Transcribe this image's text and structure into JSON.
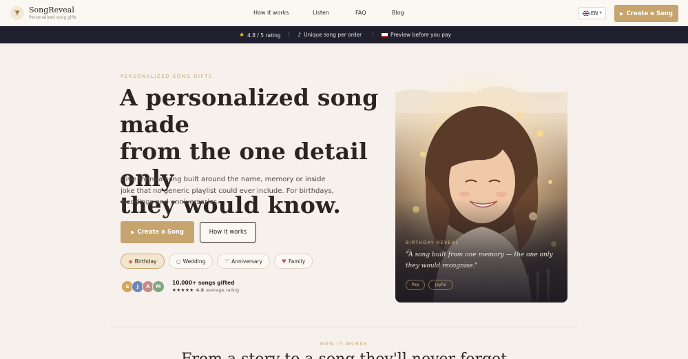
{
  "header": {
    "brand": "SongReveal",
    "tagline": "Personalized song gifts",
    "nav": [
      "How it works",
      "Listen",
      "FAQ",
      "Blog"
    ],
    "lang": "EN",
    "cta": "Create a Song"
  },
  "bar": {
    "rating": "4.8 / 5 rating",
    "unique": "Unique song per order",
    "preview": "Preview before you pay"
  },
  "hero": {
    "eyebrow": "PERSONALIZED SONG GIFTS",
    "heading_lines": [
      "A personalized song made",
      "from the one detail only",
      "they would know."
    ],
    "lead": "Give them a song built around the name, memory or inside joke that no generic playlist could ever include. For birthdays, weddings and anniversaries.",
    "primary_cta": "Create a Song",
    "secondary_cta": "How it works",
    "occasions": [
      "Birthday",
      "Wedding",
      "Anniversary",
      "Family"
    ],
    "avatars": [
      "S",
      "J",
      "A",
      "M"
    ],
    "social_title": "10,000+ songs gifted",
    "social_rating": "4.8",
    "social_rating_suffix": "average rating",
    "stars": "★★★★★"
  },
  "card": {
    "eyebrow": "BIRTHDAY REVEAL",
    "quote": "\"A song built from one memory — the one only they would recognise.\"",
    "tags": [
      "Pop",
      "Joyful"
    ]
  },
  "section": {
    "eyebrow": "HOW IT WORKS",
    "title": "From a story to a song they'll never forget"
  },
  "colors": {
    "accent": "#c7a46d",
    "dark_bar": "#1f1f2e",
    "background": "#f6f1ec",
    "avatar_colors": [
      "#d3a65c",
      "#6f86b7",
      "#c58a8a",
      "#7fa87f"
    ]
  }
}
